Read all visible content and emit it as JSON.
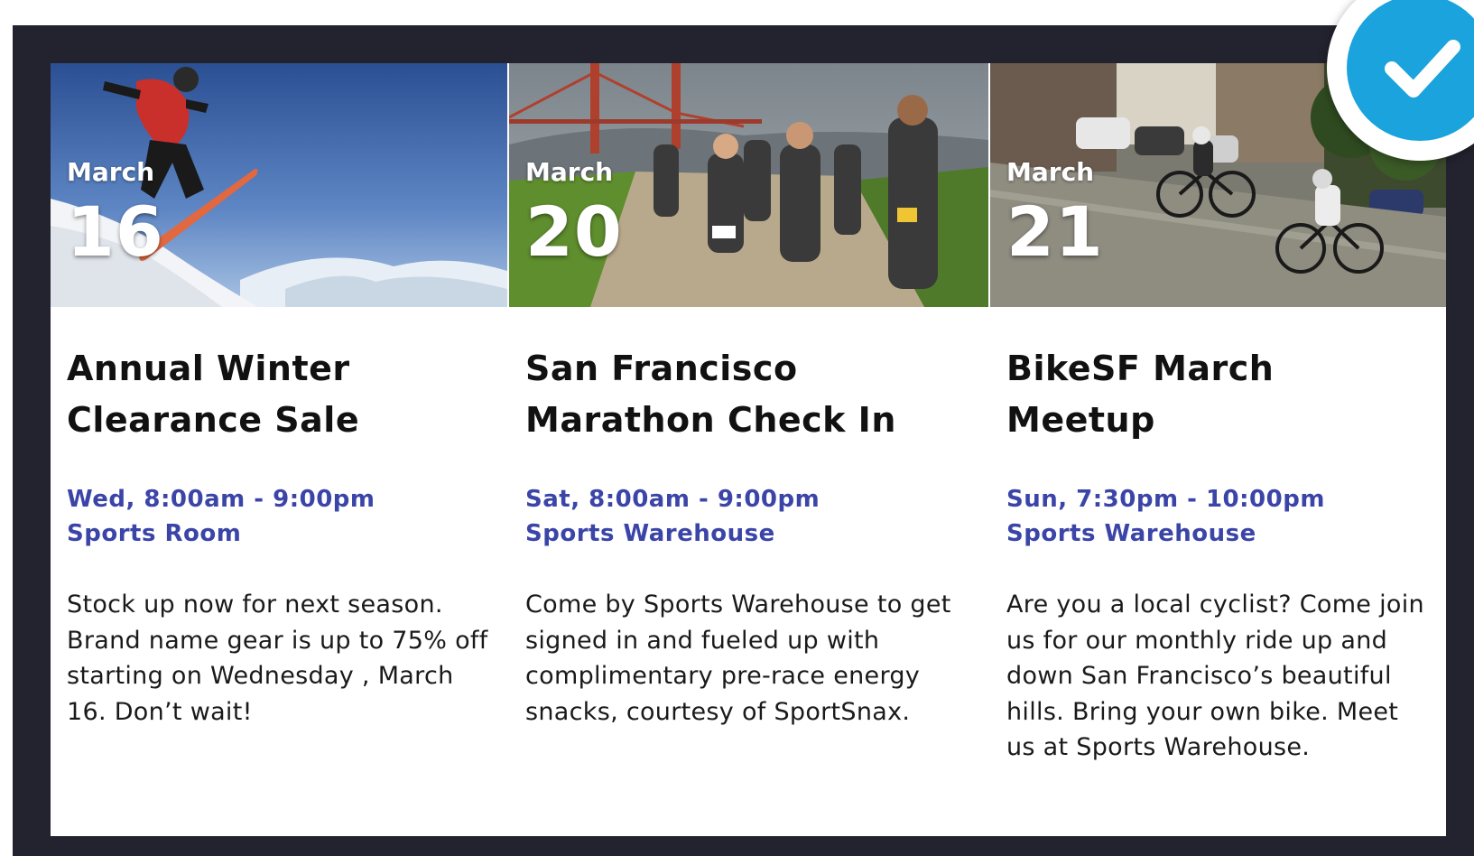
{
  "events": [
    {
      "month": "March",
      "day": "16",
      "title_line1": "Annual Winter",
      "title_line2": "Clearance Sale",
      "time": "Wed, 8:00am - 9:00pm",
      "location": "Sports Room",
      "description": "Stock up now for next season. Brand name gear is up to 75% off starting on Wednesday , March 16. Don’t wait!",
      "image": "snowboarder-photo"
    },
    {
      "month": "March",
      "day": "20",
      "title_line1": "San Francisco",
      "title_line2": "Marathon Check In",
      "time": "Sat, 8:00am - 9:00pm",
      "location": "Sports Warehouse",
      "description": "Come by Sports Warehouse to get signed in and fueled up with complimentary pre-race energy snacks, courtesy of SportSnax.",
      "image": "marathon-runners-photo"
    },
    {
      "month": "March",
      "day": "21",
      "title_line1": "BikeSF March",
      "title_line2": "Meetup",
      "time": "Sun, 7:30pm - 10:00pm",
      "location": "Sports Warehouse",
      "description": "Are you a local cyclist? Come join us for our monthly ride up and down San Francisco’s beautiful hills. Bring your own bike. Meet us at Sports Warehouse.",
      "image": "cyclists-photo"
    }
  ],
  "colors": {
    "frame": "#22232e",
    "meta_text": "#3b45a8",
    "check_badge": "#1aa3dc"
  },
  "badge": {
    "icon": "checkmark-icon"
  }
}
